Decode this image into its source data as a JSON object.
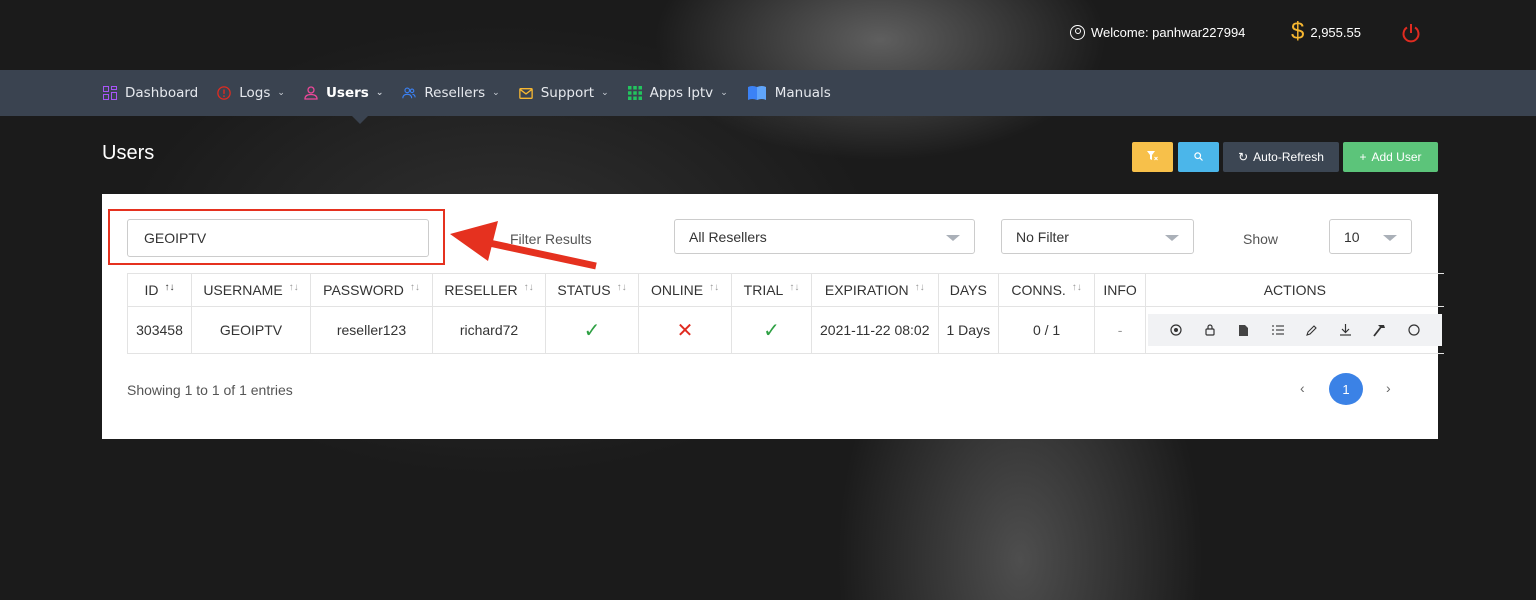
{
  "header": {
    "welcome": "Welcome: panhwar227994",
    "balance": "2,955.55"
  },
  "nav": {
    "items": [
      {
        "label": "Dashboard",
        "icon": "dashboard-icon"
      },
      {
        "label": "Logs",
        "icon": "alert-icon"
      },
      {
        "label": "Users",
        "icon": "user-icon"
      },
      {
        "label": "Resellers",
        "icon": "resellers-icon"
      },
      {
        "label": "Support",
        "icon": "mail-icon"
      },
      {
        "label": "Apps Iptv",
        "icon": "apps-grid-icon"
      },
      {
        "label": "Manuals",
        "icon": "book-icon"
      }
    ]
  },
  "page": {
    "title": "Users",
    "buttons": {
      "refresh": "Auto-Refresh",
      "add": "Add User"
    }
  },
  "filters": {
    "search_value": "GEOIPTV",
    "filter_label": "Filter Results",
    "reseller_select": "All Resellers",
    "status_select": "No Filter",
    "show_label": "Show",
    "show_select": "10"
  },
  "table": {
    "headers": [
      "ID",
      "USERNAME",
      "PASSWORD",
      "RESELLER",
      "STATUS",
      "ONLINE",
      "TRIAL",
      "EXPIRATION",
      "DAYS",
      "CONNS.",
      "INFO",
      "ACTIONS"
    ],
    "rows": [
      {
        "id": "303458",
        "username": "GEOIPTV",
        "password": "reseller123",
        "reseller": "richard72",
        "status": "check",
        "online": "cross",
        "trial": "check",
        "expiration": "2021-11-22 08:02",
        "days": "1 Days",
        "conns": "0 / 1",
        "info": "-"
      }
    ],
    "action_icons": [
      "view-icon",
      "lock-icon",
      "file-icon",
      "list-icon",
      "edit-icon",
      "download-icon",
      "hammer-icon",
      "circle-icon"
    ]
  },
  "footer": {
    "showing": "Showing 1 to 1 of 1 entries",
    "current_page": "1"
  },
  "colors": {
    "accent_blue": "#3b82e6",
    "filter_button": "#f7c04a",
    "search_button": "#4bb6ea",
    "add_button": "#5cc47a",
    "annotation_red": "#e5311f"
  }
}
